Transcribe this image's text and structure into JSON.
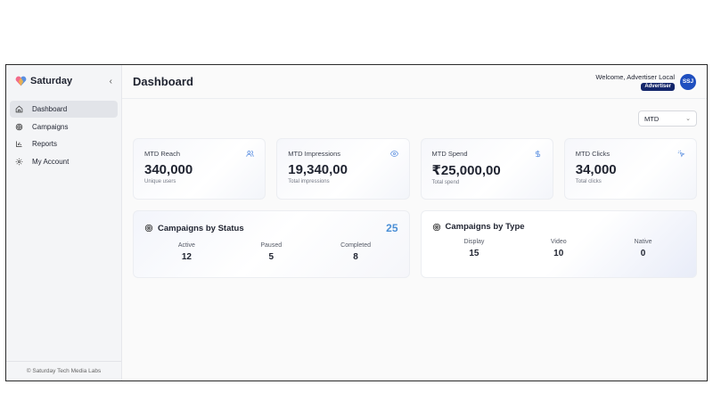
{
  "brand": {
    "name": "Saturday",
    "logo_icon": "heart-logo-icon"
  },
  "sidebar": {
    "items": [
      {
        "label": "Dashboard",
        "icon": "home-icon",
        "active": true
      },
      {
        "label": "Campaigns",
        "icon": "target-icon",
        "active": false
      },
      {
        "label": "Reports",
        "icon": "bar-chart-icon",
        "active": false
      },
      {
        "label": "My Account",
        "icon": "gear-icon",
        "active": false
      }
    ],
    "footer": "© Saturday Tech Media Labs"
  },
  "header": {
    "title": "Dashboard",
    "welcome": "Welcome, Advertiser Local",
    "role": "Advertiser",
    "avatar_initials": "SSJ"
  },
  "filter": {
    "selected": "MTD"
  },
  "metrics": [
    {
      "label": "MTD Reach",
      "value": "340,000",
      "sub": "Unique users",
      "icon": "users-icon"
    },
    {
      "label": "MTD Impressions",
      "value": "19,340,00",
      "sub": "Total impressions",
      "icon": "eye-icon"
    },
    {
      "label": "MTD Spend",
      "value": "₹25,000,00",
      "sub": "Total spend",
      "icon": "dollar-icon"
    },
    {
      "label": "MTD Clicks",
      "value": "34,000",
      "sub": "Total clicks",
      "icon": "cursor-click-icon"
    }
  ],
  "status_panel": {
    "title": "Campaigns by Status",
    "total": "25",
    "stats": [
      {
        "label": "Active",
        "value": "12"
      },
      {
        "label": "Paused",
        "value": "5"
      },
      {
        "label": "Completed",
        "value": "8"
      }
    ]
  },
  "type_panel": {
    "title": "Campaigns by Type",
    "stats": [
      {
        "label": "Display",
        "value": "15"
      },
      {
        "label": "Video",
        "value": "10"
      },
      {
        "label": "Native",
        "value": "0"
      }
    ]
  },
  "colors": {
    "accent": "#1f4fbf",
    "badge": "#14266b",
    "total": "#4a8fd6",
    "icon": "#5b8fe0"
  }
}
